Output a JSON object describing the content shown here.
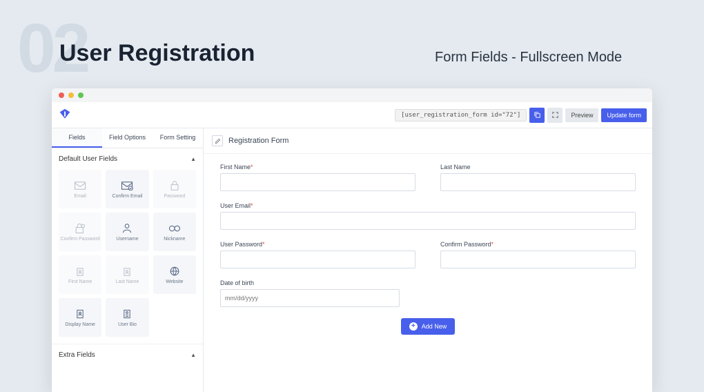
{
  "hero": {
    "number": "02",
    "title": "User Registration",
    "subtitle": "Form Fields - Fullscreen Mode"
  },
  "toolbar": {
    "shortcode": "[user_registration_form id=\"72\"]",
    "preview": "Preview",
    "update": "Update form"
  },
  "sidebar": {
    "tabs": [
      "Fields",
      "Field Options",
      "Form Setting"
    ],
    "section1": "Default User Fields",
    "fields": [
      "Email",
      "Confirm Email",
      "Password",
      "Confirm Password",
      "Username",
      "Nickname",
      "First Name",
      "Last Name",
      "Website",
      "Display Name",
      "User Bio"
    ],
    "section2": "Extra Fields"
  },
  "form": {
    "title": "Registration Form",
    "fields": {
      "first_name": "First Name",
      "last_name": "Last Name",
      "user_email": "User Email",
      "user_password": "User Password",
      "confirm_password": "Confirm Password",
      "dob": "Date of birth",
      "dob_placeholder": "mm/dd/yyyy"
    },
    "add_new": "Add New"
  }
}
